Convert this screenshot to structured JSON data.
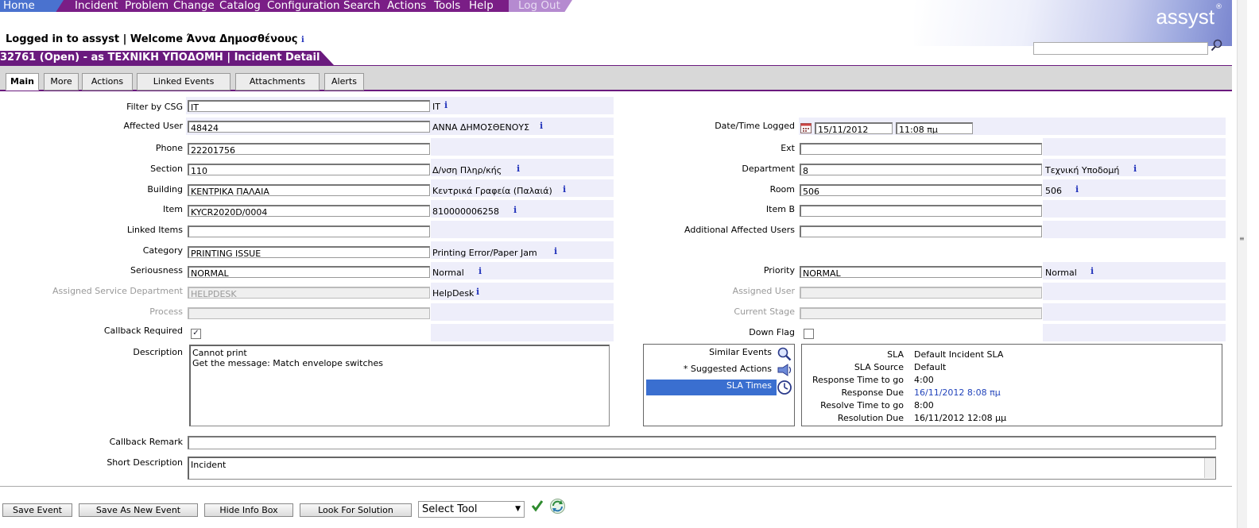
{
  "menu": {
    "home": "Home",
    "items": [
      "Incident",
      "Problem",
      "Change",
      "Catalog",
      "Configuration",
      "Search",
      "Actions",
      "Tools",
      "Help"
    ],
    "logout": "Log Out"
  },
  "logo": "assyst",
  "logo_mark": "®",
  "welcome": "Logged in to assyst | Welcome Άννα Δημοσθένους",
  "info": "i",
  "title": "32761 (Open) - as ΤΕΧΝΙΚΗ ΥΠΟΔΟΜΗ | Incident Detail",
  "tabs": [
    "Main",
    "More",
    "Actions",
    "Linked Events",
    "Attachments",
    "Alerts"
  ],
  "form": {
    "filter_csg": {
      "label": "Filter by CSG",
      "value": "IT",
      "desc": "IT"
    },
    "affected_user": {
      "label": "Affected User",
      "value": "48424",
      "desc": "ΑΝΝΑ ΔΗΜΟΣΘΕΝΟΥΣ"
    },
    "phone": {
      "label": "Phone",
      "value": "22201756"
    },
    "section": {
      "label": "Section",
      "value": "110",
      "desc": "Δ/νση Πληρ/κής"
    },
    "building": {
      "label": "Building",
      "value": "ΚΕΝΤΡΙΚΑ ΠΑΛΑΙΑ",
      "desc": "Κεντρικά Γραφεία (Παλαιά)"
    },
    "item": {
      "label": "Item",
      "value": "KYCR2020D/0004",
      "desc": "810000006258"
    },
    "linked_items": {
      "label": "Linked Items",
      "value": ""
    },
    "category": {
      "label": "Category",
      "value": "PRINTING ISSUE",
      "desc": "Printing Error/Paper Jam"
    },
    "seriousness": {
      "label": "Seriousness",
      "value": "NORMAL",
      "desc": "Normal"
    },
    "assigned_dept": {
      "label": "Assigned Service Department",
      "value": "HELPDESK",
      "desc": "HelpDesk"
    },
    "process": {
      "label": "Process",
      "value": ""
    },
    "callback_required": {
      "label": "Callback Required",
      "checked": true,
      "mark": "✓"
    },
    "description": {
      "label": "Description",
      "value": "Cannot print\nGet the message: Match envelope switches"
    },
    "callback_remark": {
      "label": "Callback Remark",
      "value": ""
    },
    "short_description": {
      "label": "Short Description",
      "value": "Incident"
    },
    "date_logged": {
      "label": "Date/Time Logged",
      "date": "15/11/2012",
      "time": "11:08 πμ"
    },
    "ext": {
      "label": "Ext",
      "value": ""
    },
    "department": {
      "label": "Department",
      "value": "8",
      "desc": "Τεχνική Υποδομή"
    },
    "room": {
      "label": "Room",
      "value": "506",
      "desc": "506"
    },
    "item_b": {
      "label": "Item B",
      "value": ""
    },
    "additional_users": {
      "label": "Additional Affected Users",
      "value": ""
    },
    "priority": {
      "label": "Priority",
      "value": "NORMAL",
      "desc": "Normal"
    },
    "assigned_user": {
      "label": "Assigned User",
      "value": ""
    },
    "current_stage": {
      "label": "Current Stage",
      "value": ""
    },
    "down_flag": {
      "label": "Down Flag",
      "checked": false
    }
  },
  "info_box": {
    "links": [
      "Similar Events",
      "* Suggested Actions",
      "SLA Times"
    ],
    "sla": [
      {
        "label": "SLA",
        "value": "Default Incident SLA"
      },
      {
        "label": "SLA Source",
        "value": "Default"
      },
      {
        "label": "Response Time to go",
        "value": "4:00"
      },
      {
        "label": "Response Due",
        "value": "16/11/2012 8:08 πμ"
      },
      {
        "label": "Resolve Time to go",
        "value": "8:00"
      },
      {
        "label": "Resolution Due",
        "value": "16/11/2012 12:08 μμ"
      }
    ]
  },
  "buttons": {
    "save": "Save Event",
    "save_new": "Save As New Event",
    "hide_info": "Hide Info Box",
    "look_solution": "Look For Solution",
    "select_tool": "Select Tool"
  },
  "colors": {
    "menu_purple": "#7a1e86",
    "title_purple": "#6a1a7e",
    "row_bg": "#eeeefa",
    "sla_selected": "#3a6fd0",
    "link_blue": "#2244bb"
  }
}
